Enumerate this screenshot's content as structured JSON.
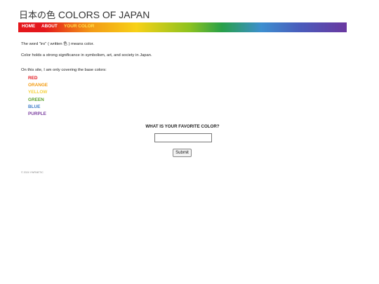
{
  "site": {
    "title_jp": "日本の色",
    "title_en": "COLORS OF JAPAN"
  },
  "nav": {
    "home": "HOME",
    "about": "ABOUT",
    "your_color": "YOUR COLOR"
  },
  "content": {
    "line1": "The word \"iro\" ( written 色 ) means color.",
    "line2": "Color holds a strong significance in symbolism, art, and society in Japan.",
    "line3": "On this site, I am only covering the base colors:",
    "colors": [
      {
        "label": "RED",
        "color": "#e31b23"
      },
      {
        "label": "ORANGE",
        "color": "#f39c12"
      },
      {
        "label": "YELLOW",
        "color": "#f4d03f"
      },
      {
        "label": "GREEN",
        "color": "#5aa02c"
      },
      {
        "label": "BLUE",
        "color": "#3b7bc6"
      },
      {
        "label": "PURPLE",
        "color": "#7b3fa0"
      }
    ]
  },
  "form": {
    "question": "WHAT IS YOUR FAVORITE COLOR?",
    "answer_value": "",
    "submit_label": "Submit"
  },
  "footer": {
    "copyright": "© 2024 YWRNETIC"
  }
}
